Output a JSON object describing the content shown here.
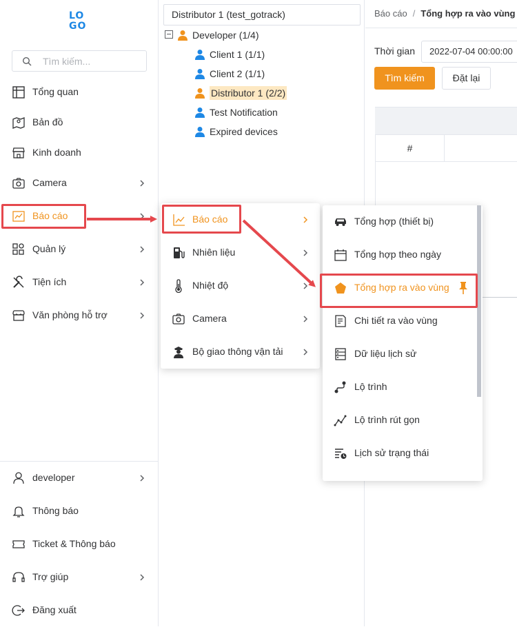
{
  "logo": {
    "line1": "LO",
    "line2": "GO"
  },
  "search": {
    "placeholder": "Tìm kiếm..."
  },
  "sidebar": {
    "items": [
      {
        "label": "Tổng quan"
      },
      {
        "label": "Bản đồ"
      },
      {
        "label": "Kinh doanh"
      },
      {
        "label": "Camera"
      },
      {
        "label": "Báo cáo"
      },
      {
        "label": "Quản lý"
      },
      {
        "label": "Tiện ích"
      },
      {
        "label": "Văn phòng hỗ trợ"
      }
    ],
    "bottom": [
      {
        "label": "developer"
      },
      {
        "label": "Thông báo"
      },
      {
        "label": "Ticket & Thông báo"
      },
      {
        "label": "Trợ giúp"
      },
      {
        "label": "Đăng xuất"
      }
    ]
  },
  "tree": {
    "selector": "Distributor 1 (test_gotrack)",
    "root": "Developer (1/4)",
    "children": [
      "Client 1 (1/1)",
      "Client 2 (1/1)",
      "Distributor 1 (2/2)",
      "Test Notification",
      "Expired devices"
    ]
  },
  "main": {
    "breadcrumb": {
      "parent": "Báo cáo",
      "separator": "/",
      "current": "Tổng hợp ra vào vùng"
    },
    "time_label": "Thời gian",
    "time_value": "2022-07-04 00:00:00",
    "search_button": "Tìm kiếm",
    "reset_button": "Đặt lại",
    "table_header_index": "#"
  },
  "submenu1": {
    "items": [
      {
        "label": "Báo cáo"
      },
      {
        "label": "Nhiên liệu"
      },
      {
        "label": "Nhiệt độ"
      },
      {
        "label": "Camera"
      },
      {
        "label": "Bộ giao thông vận tải"
      }
    ]
  },
  "submenu2": {
    "items": [
      {
        "label": "Tổng hợp (thiết bị)"
      },
      {
        "label": "Tổng hợp theo ngày"
      },
      {
        "label": "Tổng hợp ra vào vùng"
      },
      {
        "label": "Chi tiết ra vào vùng"
      },
      {
        "label": "Dữ liệu lịch sử"
      },
      {
        "label": "Lộ trình"
      },
      {
        "label": "Lộ trình rút gọn"
      },
      {
        "label": "Lịch sử trạng thái"
      }
    ]
  },
  "colors": {
    "accent": "#f0931e",
    "highlight": "#e5484d",
    "tree_user": "#1e88e5",
    "tree_selected_bg": "#fde8c2"
  }
}
